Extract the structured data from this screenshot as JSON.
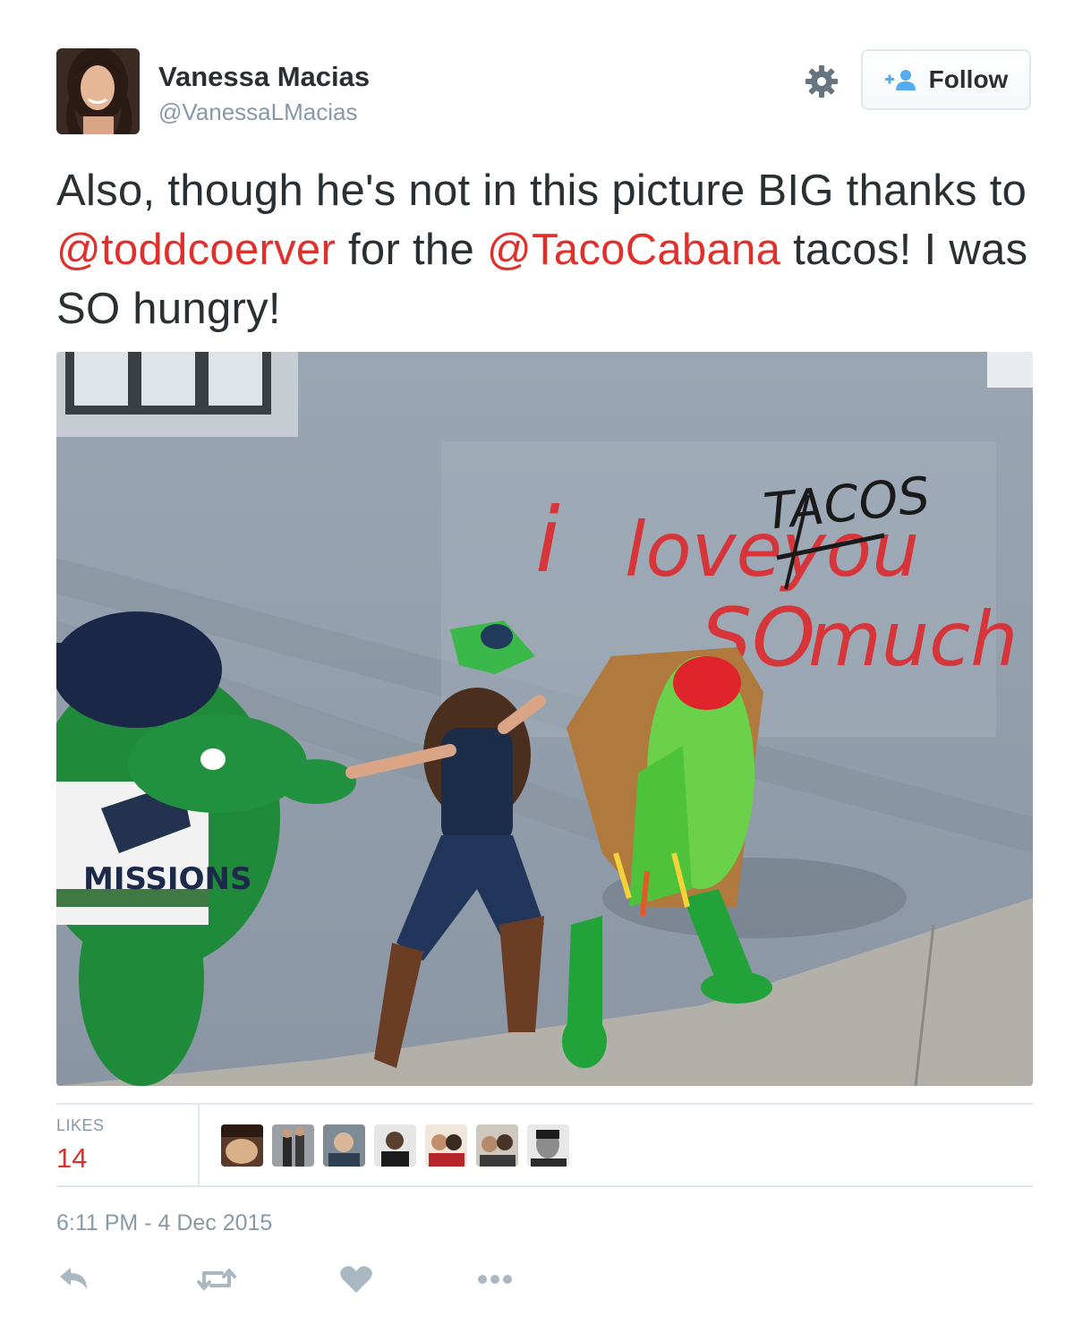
{
  "user": {
    "display_name": "Vanessa Macias",
    "handle": "@VanessaLMacias"
  },
  "header": {
    "follow_label": "Follow"
  },
  "tweet": {
    "text_part1": "Also, though he's not in this picture BIG thanks to ",
    "mention1": "@toddcoerver",
    "text_part2": " for the ",
    "mention2": "@TacoCabana",
    "text_part3": " tacos! I was SO hungry!"
  },
  "photo": {
    "graffiti": {
      "i": "i",
      "love": "love",
      "you": "you",
      "tacos": "TACOS",
      "so": "SO",
      "much": "much"
    },
    "jersey_text": "MISSIONS"
  },
  "stats": {
    "likes_label": "LIKES",
    "likes_count": "14"
  },
  "timestamp": "6:11 PM - 4 Dec 2015",
  "colors": {
    "mention": "#e0302b",
    "muted": "#8899a6",
    "text": "#292f33",
    "divider": "#e1e8ed"
  },
  "icons": {
    "settings": "gear-icon",
    "follow": "follow-person-icon",
    "reply": "reply-icon",
    "retweet": "retweet-icon",
    "like": "heart-icon",
    "more": "more-icon"
  }
}
